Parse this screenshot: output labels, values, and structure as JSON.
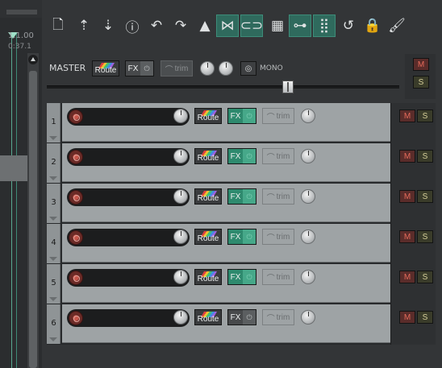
{
  "ruler": {
    "time_bar": "1.1.00",
    "time_sec": "0:37.1"
  },
  "toolbar": {
    "buttons": [
      {
        "name": "new-project-icon",
        "glyph": "🗋"
      },
      {
        "name": "save-upload-icon",
        "glyph": "⇡"
      },
      {
        "name": "open-download-icon",
        "glyph": "⇣"
      },
      {
        "name": "info-icon",
        "glyph": "ⓘ"
      },
      {
        "name": "undo-icon",
        "glyph": "↶"
      },
      {
        "name": "redo-icon",
        "glyph": "↷"
      },
      {
        "name": "metronome-icon",
        "glyph": "▲"
      },
      {
        "name": "auto-crossfade-icon",
        "glyph": "⋈"
      },
      {
        "name": "link-chain-icon",
        "glyph": "⊂⊃"
      },
      {
        "name": "grid-icon",
        "glyph": "▦"
      },
      {
        "name": "group-link-icon",
        "glyph": "⊶"
      },
      {
        "name": "snap-grid-icon",
        "glyph": "⣿"
      },
      {
        "name": "loop-repeat-icon",
        "glyph": "↺"
      },
      {
        "name": "lock-icon",
        "glyph": "🔒"
      },
      {
        "name": "theme-color-icon",
        "glyph": "🖌"
      }
    ]
  },
  "master": {
    "label": "MASTER",
    "route_label": "Route",
    "fx_label": "FX",
    "trim_label": "trim",
    "mono_label": "MONO",
    "mute_label": "M",
    "solo_label": "S",
    "volume_fraction": 0.69
  },
  "tracks": [
    {
      "number": "1",
      "route_label": "Route",
      "fx_label": "FX",
      "fx_active": true,
      "trim_label": "trim",
      "mute_label": "M",
      "solo_label": "S"
    },
    {
      "number": "2",
      "route_label": "Route",
      "fx_label": "FX",
      "fx_active": true,
      "trim_label": "trim",
      "mute_label": "M",
      "solo_label": "S"
    },
    {
      "number": "3",
      "route_label": "Route",
      "fx_label": "FX",
      "fx_active": true,
      "trim_label": "trim",
      "mute_label": "M",
      "solo_label": "S"
    },
    {
      "number": "4",
      "route_label": "Route",
      "fx_label": "FX",
      "fx_active": true,
      "trim_label": "trim",
      "mute_label": "M",
      "solo_label": "S"
    },
    {
      "number": "5",
      "route_label": "Route",
      "fx_label": "FX",
      "fx_active": true,
      "trim_label": "trim",
      "mute_label": "M",
      "solo_label": "S"
    },
    {
      "number": "6",
      "route_label": "Route",
      "fx_label": "FX",
      "fx_active": false,
      "trim_label": "trim",
      "mute_label": "M",
      "solo_label": "S"
    }
  ],
  "colors": {
    "accent_green": "#2e8a6e",
    "track_bg": "#9ea3a5",
    "panel_bg": "#333537",
    "mute_red": "#e46a5a"
  }
}
